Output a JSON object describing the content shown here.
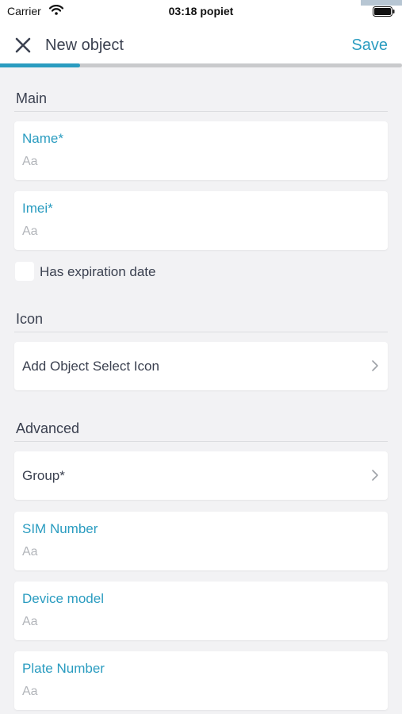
{
  "status_bar": {
    "carrier": "Carrier",
    "time": "03:18 popiet"
  },
  "nav": {
    "title": "New object",
    "save_label": "Save",
    "progress": 0.2
  },
  "sections": {
    "main": "Main",
    "icon": "Icon",
    "advanced": "Advanced"
  },
  "fields": {
    "name": {
      "label": "Name*",
      "placeholder": "Aa",
      "value": ""
    },
    "imei": {
      "label": "Imei*",
      "placeholder": "Aa",
      "value": ""
    },
    "sim": {
      "label": "SIM Number",
      "placeholder": "Aa",
      "value": ""
    },
    "device_model": {
      "label": "Device model",
      "placeholder": "Aa",
      "value": ""
    },
    "plate": {
      "label": "Plate Number",
      "placeholder": "Aa",
      "value": ""
    }
  },
  "expiration": {
    "label": "Has expiration date",
    "checked": false
  },
  "icon_row": {
    "label": "Add Object Select Icon"
  },
  "group_row": {
    "label": "Group*"
  },
  "colors": {
    "accent": "#2a9cc0",
    "text": "#3b4150",
    "background": "#f2f2f4",
    "placeholder": "#b2b5ba"
  },
  "icons": [
    "wifi-icon",
    "battery-icon",
    "close-icon",
    "chevron-right-icon"
  ]
}
